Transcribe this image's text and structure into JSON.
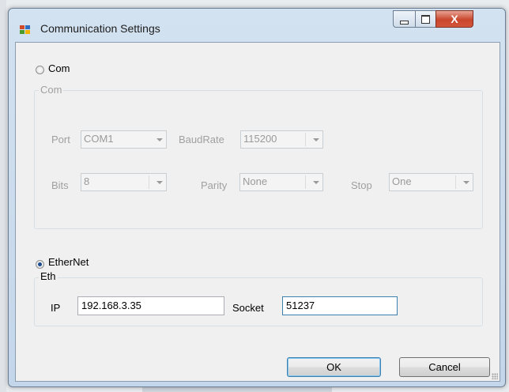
{
  "window": {
    "title": "Communication Settings",
    "close_glyph": "X",
    "icons": {
      "app": "app-window-icon",
      "minimize": "minimize-icon",
      "maximize": "maximize-icon",
      "close": "close-icon"
    }
  },
  "com": {
    "radio_label": "Com",
    "selected": false,
    "group_label": "Com",
    "port": {
      "label": "Port",
      "value": "COM1"
    },
    "baudrate": {
      "label": "BaudRate",
      "value": "115200"
    },
    "bits": {
      "label": "Bits",
      "value": "8"
    },
    "parity": {
      "label": "Parity",
      "value": "None"
    },
    "stop": {
      "label": "Stop",
      "value": "One"
    }
  },
  "ethernet": {
    "radio_label": "EtherNet",
    "selected": true,
    "group_label": "Eth",
    "ip": {
      "label": "IP",
      "value": "192.168.3.35"
    },
    "socket": {
      "label": "Socket",
      "value": "51237"
    }
  },
  "buttons": {
    "ok": "OK",
    "cancel": "Cancel"
  },
  "colors": {
    "app_icon": [
      "#d04a2a",
      "#2f6fc2",
      "#4c9a2a",
      "#f0b400"
    ]
  }
}
